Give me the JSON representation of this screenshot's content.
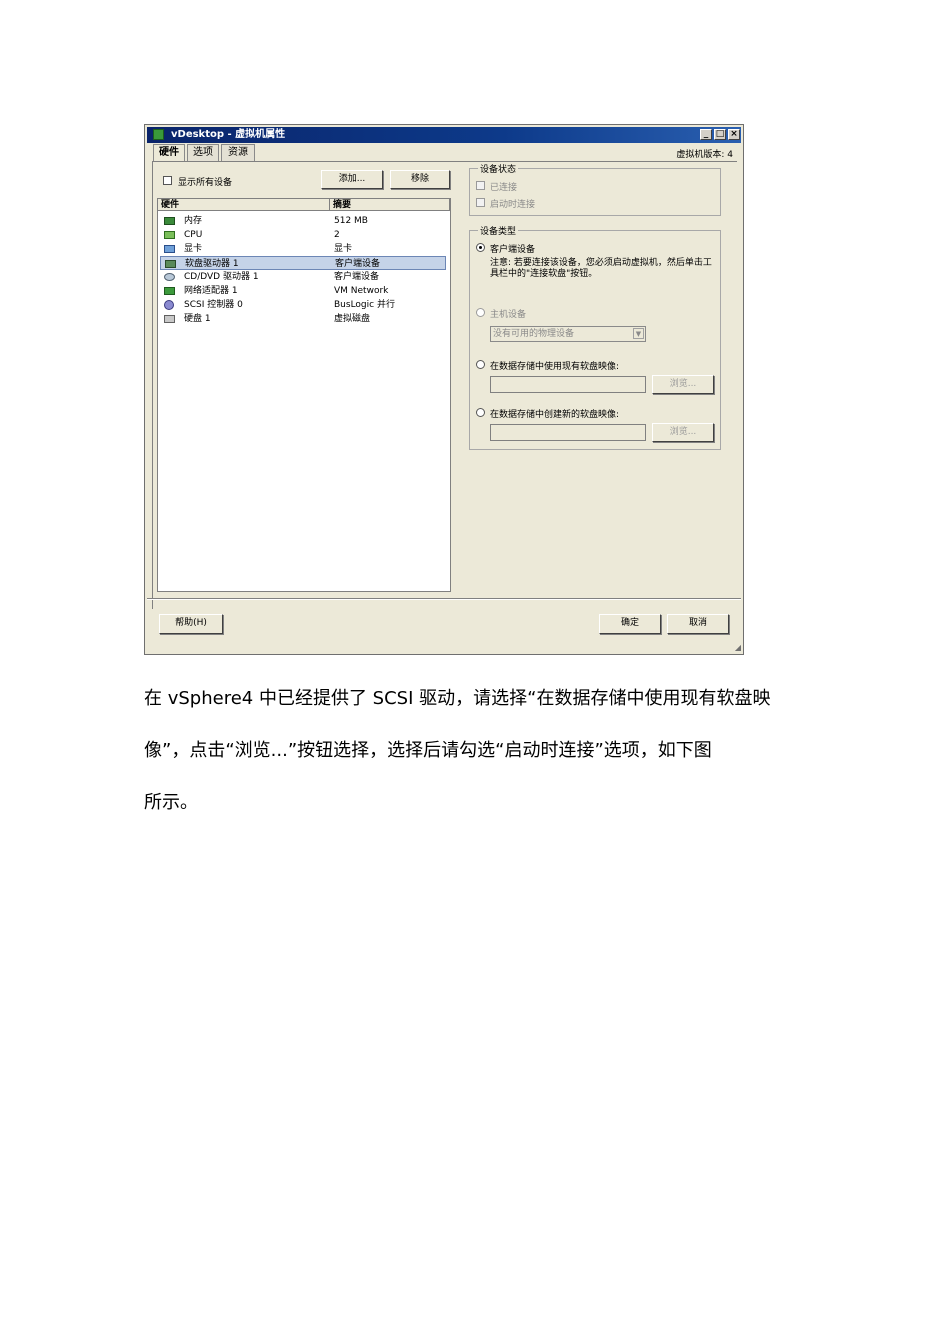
{
  "window": {
    "title": "vDesktop - 虚拟机属性",
    "version_label": "虚拟机版本: 4",
    "tabs": [
      {
        "label": "硬件",
        "active": true
      },
      {
        "label": "选项",
        "active": false
      },
      {
        "label": "资源",
        "active": false
      }
    ],
    "show_all_devices": "显示所有设备",
    "add_button": "添加...",
    "remove_button": "移除",
    "hardware_header": "硬件",
    "summary_header": "摘要",
    "devices": [
      {
        "name": "内存",
        "summary": "512 MB",
        "icon": "memory-icon"
      },
      {
        "name": "CPU",
        "summary": "2",
        "icon": "cpu-icon"
      },
      {
        "name": "显卡",
        "summary": "显卡",
        "icon": "display-icon"
      },
      {
        "name": "软盘驱动器 1",
        "summary": "客户端设备",
        "icon": "floppy-icon",
        "selected": true
      },
      {
        "name": "CD/DVD 驱动器 1",
        "summary": "客户端设备",
        "icon": "cdrom-icon"
      },
      {
        "name": "网络适配器 1",
        "summary": "VM Network",
        "icon": "network-icon"
      },
      {
        "name": "SCSI 控制器 0",
        "summary": "BusLogic 并行",
        "icon": "scsi-icon"
      },
      {
        "name": "硬盘 1",
        "summary": "虚拟磁盘",
        "icon": "disk-icon"
      }
    ],
    "device_status": {
      "title": "设备状态",
      "connected": "已连接",
      "connect_at_power_on": "启动时连接"
    },
    "device_type": {
      "title": "设备类型",
      "client_device": "客户端设备",
      "note": "注意: 若要连接该设备，您必须启动虚拟机，然后单击工具栏中的\"连接软盘\"按钮。",
      "host_device": "主机设备",
      "host_device_select": "没有可用的物理设备",
      "use_existing_image": "在数据存储中使用现有软盘映像:",
      "browse_button": "浏览...",
      "create_new_image": "在数据存储中创建新的软盘映像:",
      "browse_button_2": "浏览..."
    },
    "help_button": "帮助(H)",
    "ok_button": "确定",
    "cancel_button": "取消"
  },
  "paragraph": {
    "line1": "在 vSphere4 中已经提供了 SCSI 驱动，请选择“在数据存储中使用现有软盘映",
    "line2": "像”，点击“浏览...”按钮选择，选择后请勾选“启动时连接”选项，如下图",
    "line3": "所示。"
  }
}
